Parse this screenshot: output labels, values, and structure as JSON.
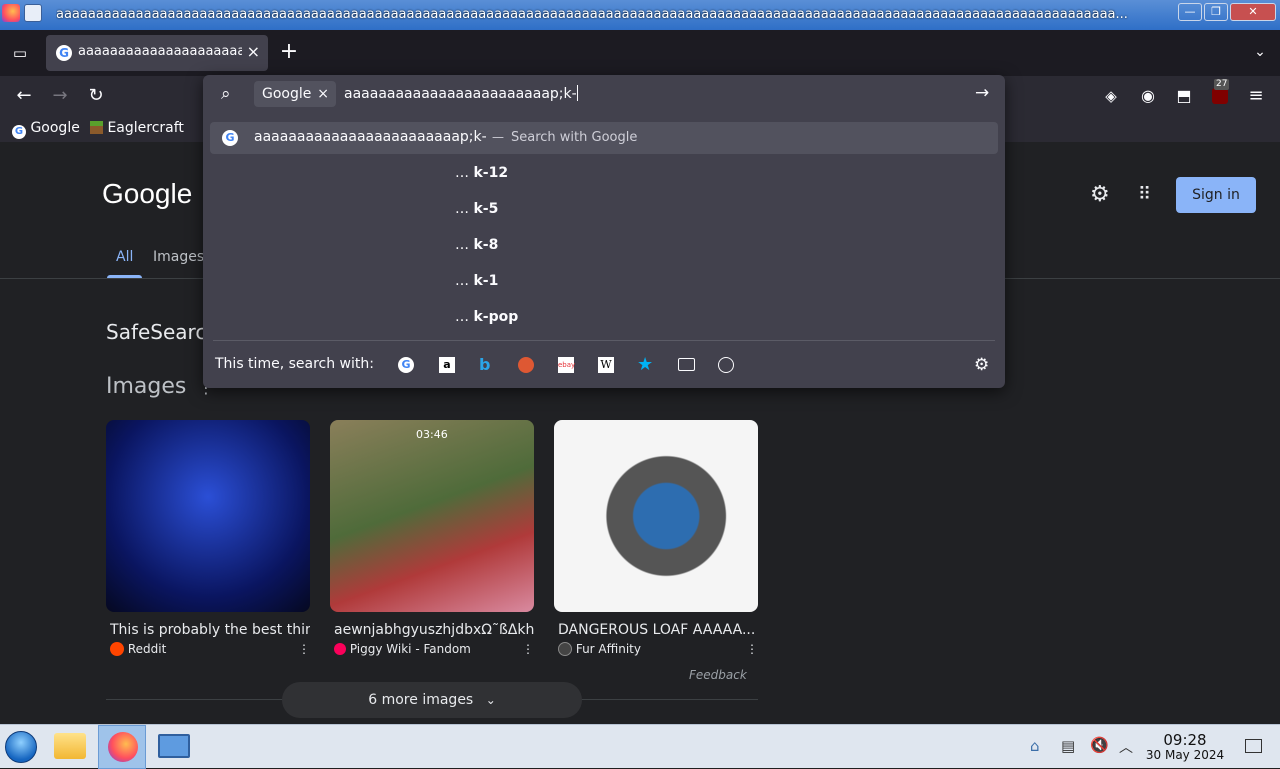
{
  "window": {
    "title": "aaaaaaaaaaaaaaaaaaaaaaaaaaaaaaaaaaaaaaaaaaaaaaaaaaaaaaaaaaaaaaaaaaaaaaaaaaaaaaaaaaaaaaaaaaaaaaaaaaaaaaaaaaaaaaaaaaaaaaaaaaaaaaaaaaaaa...",
    "minimize": "—",
    "maximize": "❐",
    "close": "✕"
  },
  "tabs": [
    {
      "label": "aaaaaaaaaaaaaaaaaaaaaaaaaaa",
      "favicon": "G"
    }
  ],
  "tab_close": "×",
  "new_tab": "+",
  "nav": {
    "back": "←",
    "forward": "→",
    "reload": "↻"
  },
  "bookmarks": [
    {
      "label": "Google"
    },
    {
      "label": "Eaglercraft"
    }
  ],
  "toolbar": {
    "extension_badge": "27"
  },
  "urlbar": {
    "engine_chip": "Google",
    "chip_close": "×",
    "query": "aaaaaaaaaaaaaaaaaaaaaaaap;k-",
    "go": "→",
    "first_suggestion": "aaaaaaaaaaaaaaaaaaaaaaaap;k-",
    "first_suggestion_action": "Search with Google",
    "suggestions": [
      "k-12",
      "k-5",
      "k-8",
      "k-1",
      "k-pop"
    ],
    "ellipsis": "…",
    "search_with_label": "This time, search with:"
  },
  "google": {
    "logo": "Google",
    "tabs": [
      "All",
      "Images"
    ],
    "safesearch": "SafeSearch",
    "sign_in": "Sign in",
    "images_heading": "Images",
    "images": [
      {
        "title": "This is probably the best thin...",
        "source": "Reddit"
      },
      {
        "title": "aewnjabhgyuszhjdbxΩ˜ßΔkh...",
        "source": "Piggy Wiki - Fandom",
        "time": "03:46"
      },
      {
        "title": "DANGEROUS LOAF AAAAA...",
        "source": "Fur Affinity"
      }
    ],
    "feedback": "Feedback",
    "more_images": "6 more images"
  },
  "taskbar": {
    "time": "09:28",
    "date": "30 May 2024"
  },
  "colors": {
    "accent": "#8ab4f8",
    "page_bg": "#202124",
    "urlbar_bg": "#42414d",
    "signin_bg": "#8ab4f8"
  }
}
